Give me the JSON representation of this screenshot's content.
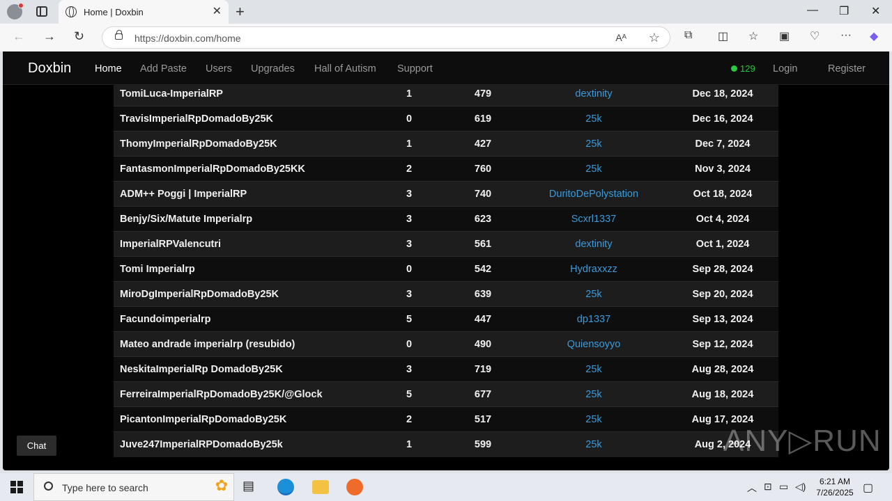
{
  "browser": {
    "tab_title": "Home | Doxbin",
    "url": "https://doxbin.com/home",
    "read_aloud": "Aᴬ",
    "new_tab": "+",
    "close_tab": "✕",
    "minimize": "—",
    "maximize": "❐",
    "close_window": "✕",
    "back": "←",
    "forward": "→",
    "refresh": "↻",
    "favorite_icon": "☆",
    "menu_icon": "···"
  },
  "site": {
    "brand": "Doxbin",
    "nav": [
      "Home",
      "Add Paste",
      "Users",
      "Upgrades",
      "Hall of Autism",
      "Support"
    ],
    "online_count": "129",
    "login": "Login",
    "register": "Register",
    "chat": "Chat"
  },
  "pastes": [
    {
      "title": "TomiLuca-ImperialRP",
      "comments": "1",
      "views": "479",
      "creator": "dextinity",
      "date": "Dec 18, 2024"
    },
    {
      "title": "TravisImperialRpDomadoBy25K",
      "comments": "0",
      "views": "619",
      "creator": "25k",
      "date": "Dec 16, 2024"
    },
    {
      "title": "ThomyImperialRpDomadoBy25K",
      "comments": "1",
      "views": "427",
      "creator": "25k",
      "date": "Dec 7, 2024"
    },
    {
      "title": "FantasmonImperialRpDomadoBy25KK",
      "comments": "2",
      "views": "760",
      "creator": "25k",
      "date": "Nov 3, 2024"
    },
    {
      "title": "ADM++ Poggi | ImperialRP",
      "comments": "3",
      "views": "740",
      "creator": "DuritoDePolystation",
      "date": "Oct 18, 2024"
    },
    {
      "title": "Benjy/Six/Matute Imperialrp",
      "comments": "3",
      "views": "623",
      "creator": "Scxrl1337",
      "date": "Oct 4, 2024"
    },
    {
      "title": "ImperialRPValencutri",
      "comments": "3",
      "views": "561",
      "creator": "dextinity",
      "date": "Oct 1, 2024"
    },
    {
      "title": "Tomi Imperialrp",
      "comments": "0",
      "views": "542",
      "creator": "Hydraxxzz",
      "date": "Sep 28, 2024"
    },
    {
      "title": "MiroDgImperialRpDomadoBy25K",
      "comments": "3",
      "views": "639",
      "creator": "25k",
      "date": "Sep 20, 2024"
    },
    {
      "title": "Facundoimperialrp",
      "comments": "5",
      "views": "447",
      "creator": "dp1337",
      "date": "Sep 13, 2024"
    },
    {
      "title": "Mateo andrade imperialrp (resubido)",
      "comments": "0",
      "views": "490",
      "creator": "Quiensoyyo",
      "date": "Sep 12, 2024"
    },
    {
      "title": "NeskitaImperialRp DomadoBy25K",
      "comments": "3",
      "views": "719",
      "creator": "25k",
      "date": "Aug 28, 2024"
    },
    {
      "title": "FerreiraImperialRpDomadoBy25K/@Glock",
      "comments": "5",
      "views": "677",
      "creator": "25k",
      "date": "Aug 18, 2024"
    },
    {
      "title": "PicantonImperialRpDomadoBy25K",
      "comments": "2",
      "views": "517",
      "creator": "25k",
      "date": "Aug 17, 2024"
    },
    {
      "title": "Juve247ImperialRPDomadoBy25k",
      "comments": "1",
      "views": "599",
      "creator": "25k",
      "date": "Aug 2, 2024"
    }
  ],
  "watermark": "ANY▷RUN",
  "taskbar": {
    "search_placeholder": "Type here to search",
    "time": "6:21 AM",
    "date": "7/26/2025"
  }
}
